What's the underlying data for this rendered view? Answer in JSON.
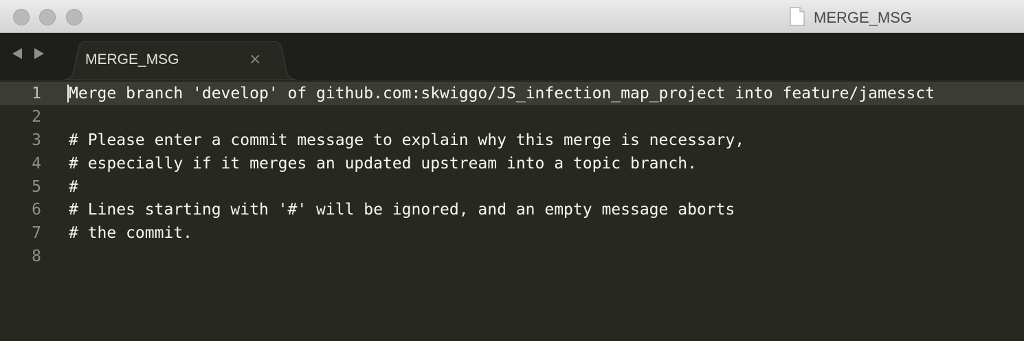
{
  "window": {
    "title": "MERGE_MSG"
  },
  "tabbar": {
    "back_icon": "triangle-left",
    "forward_icon": "triangle-right",
    "tabs": [
      {
        "label": "MERGE_MSG",
        "close": "×"
      }
    ]
  },
  "editor": {
    "lines": [
      {
        "number": "1",
        "text": "Merge branch 'develop' of github.com:skwiggo/JS_infection_map_project into feature/jamessct"
      },
      {
        "number": "2",
        "text": ""
      },
      {
        "number": "3",
        "text": "# Please enter a commit message to explain why this merge is necessary,"
      },
      {
        "number": "4",
        "text": "# especially if it merges an updated upstream into a topic branch."
      },
      {
        "number": "5",
        "text": "#"
      },
      {
        "number": "6",
        "text": "# Lines starting with '#' will be ignored, and an empty message aborts"
      },
      {
        "number": "7",
        "text": "# the commit."
      },
      {
        "number": "8",
        "text": ""
      }
    ],
    "active_line": "1"
  },
  "colors": {
    "background": "#272822",
    "active_line": "#3b3c35",
    "text": "#f8f8f2",
    "gutter_text": "#8f908a",
    "tabbar": "#1e1f1b"
  }
}
